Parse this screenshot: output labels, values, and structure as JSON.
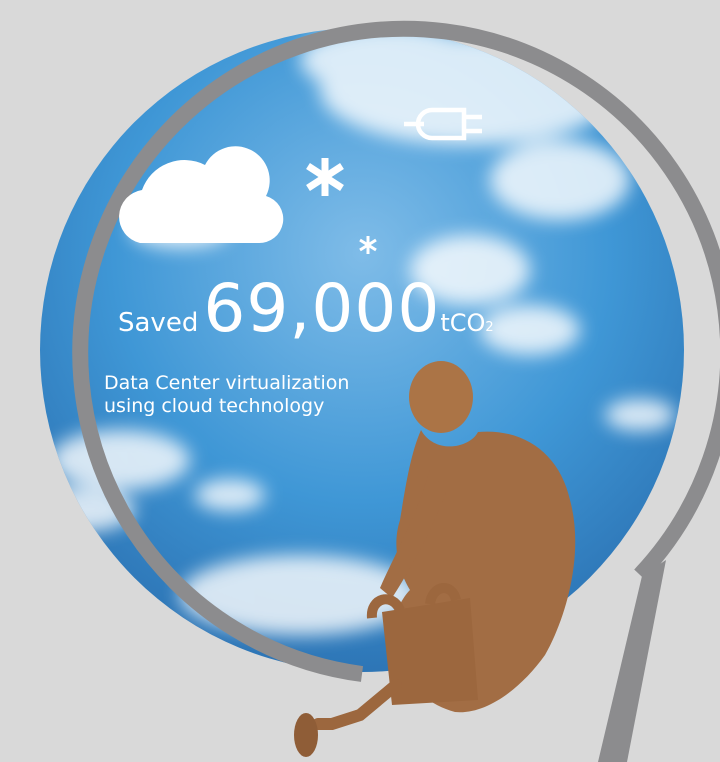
{
  "headline": {
    "label": "Saved",
    "value": "69,000",
    "unit_prefix": "tCO",
    "unit_subscript": "2"
  },
  "caption": {
    "line1": "Data Center virtualization",
    "line2": "using cloud technology"
  },
  "colors": {
    "background": "#d9d9d9",
    "ring": "#8c8c8e",
    "sky": "#3f97d6",
    "figure": "#a26d44"
  },
  "icons": [
    "cloud-icon",
    "asterisk-icon",
    "plug-icon"
  ]
}
